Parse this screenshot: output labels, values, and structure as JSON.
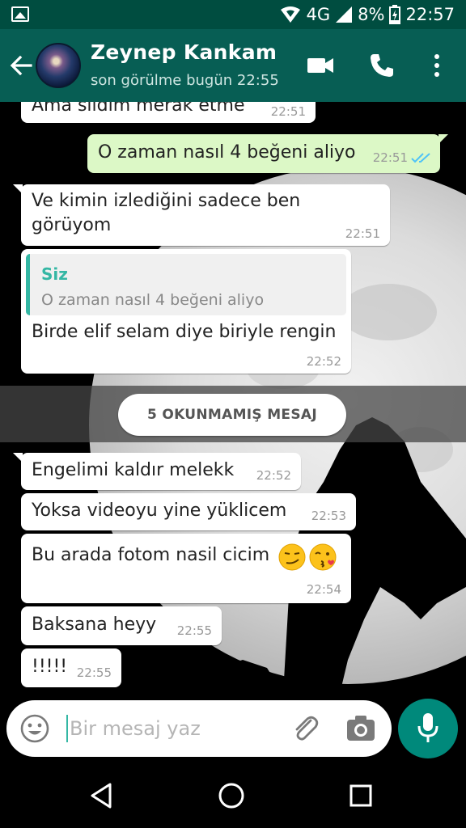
{
  "status_bar": {
    "network": "4G",
    "battery": "8%",
    "time": "22:57"
  },
  "header": {
    "contact_name": "Zeynep Kankam",
    "last_seen": "son görülme bugün 22:55"
  },
  "messages": [
    {
      "direction": "in",
      "text": "Ama sildim merak etme",
      "time": "22:51"
    },
    {
      "direction": "out",
      "text": "O zaman nasıl 4 beğeni aliyo",
      "time": "22:51",
      "status": "read"
    },
    {
      "direction": "in",
      "lines": [
        "Ve kimin izlediğini sadece ben",
        "görüyom"
      ],
      "time": "22:51"
    },
    {
      "direction": "in",
      "quote": {
        "author": "Siz",
        "text": "O zaman nasıl 4 beğeni aliyo"
      },
      "text": "Birde elif selam diye biriyle rengin",
      "time": "22:52"
    },
    {
      "direction": "in",
      "text": "Engelimi kaldır melekk",
      "time": "22:52"
    },
    {
      "direction": "in",
      "text": "Yoksa videoyu yine yüklicem",
      "time": "22:53"
    },
    {
      "direction": "in",
      "text": "Bu arada fotom nasil cicim",
      "emojis": [
        "smirking-face",
        "kissing-face"
      ],
      "time": "22:54"
    },
    {
      "direction": "in",
      "text": "Baksana heyy",
      "time": "22:55"
    },
    {
      "direction": "in",
      "text": "!!!!!",
      "time": "22:55"
    }
  ],
  "unread_divider": "5 OKUNMAMIŞ MESAJ",
  "composer": {
    "placeholder": "Bir mesaj yaz"
  },
  "colors": {
    "status_bar": "#004d40",
    "app_bar": "#075e54",
    "outgoing_bubble": "#dcf8c6",
    "incoming_bubble": "#ffffff",
    "accent": "#34b7a4",
    "mic_button": "#00897b",
    "read_ticks": "#4fc3f7"
  },
  "icons": {
    "status_left": "gallery-icon",
    "status_right": [
      "hotspot-icon",
      "signal-icon",
      "battery-icon"
    ],
    "app_bar": [
      "back-arrow-icon",
      "video-call-icon",
      "phone-icon",
      "more-vert-icon"
    ],
    "composer": [
      "emoji-icon",
      "attach-icon",
      "camera-icon",
      "mic-icon"
    ],
    "nav": [
      "back-triangle-icon",
      "home-circle-icon",
      "recents-square-icon"
    ]
  }
}
